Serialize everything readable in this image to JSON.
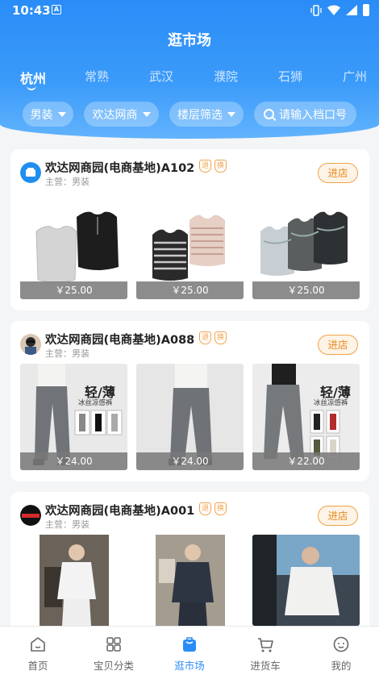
{
  "status_bar": {
    "time": "10:43",
    "app_icon_letter": "A"
  },
  "page_title": "逛市场",
  "cities": [
    "杭州",
    "常熟",
    "武汉",
    "濮院",
    "石狮",
    "广州"
  ],
  "active_city_index": 0,
  "filters": {
    "category": "男装",
    "market": "欢达网商",
    "floor": "楼层筛选",
    "search_placeholder": "请输入档口号"
  },
  "shops": [
    {
      "name": "欢达网商园(电商基地)A102",
      "tags": [
        "退",
        "换"
      ],
      "subtitle": "主营：男装",
      "enter_label": "进店",
      "products": [
        {
          "price": "￥25.00"
        },
        {
          "price": "￥25.00"
        },
        {
          "price": "￥25.00"
        }
      ]
    },
    {
      "name": "欢达网商园(电商基地)A088",
      "tags": [
        "退",
        "换"
      ],
      "subtitle": "主营：男装",
      "enter_label": "进店",
      "products": [
        {
          "price": "￥24.00",
          "overlay_big": "轻/薄",
          "overlay_small": "冰丝凉感裤"
        },
        {
          "price": "￥24.00"
        },
        {
          "price": "￥22.00",
          "overlay_big": "轻/薄",
          "overlay_small": "冰丝凉感裤"
        }
      ]
    },
    {
      "name": "欢达网商园(电商基地)A001",
      "tags": [
        "退",
        "换"
      ],
      "subtitle": "主营：男装",
      "enter_label": "进店",
      "products": [
        {
          "price": ""
        },
        {
          "price": ""
        },
        {
          "price": ""
        }
      ]
    }
  ],
  "tab_bar": [
    {
      "label": "首页",
      "icon": "home-icon"
    },
    {
      "label": "宝贝分类",
      "icon": "grid-icon"
    },
    {
      "label": "逛市场",
      "icon": "market-bag-icon"
    },
    {
      "label": "进货车",
      "icon": "cart-icon"
    },
    {
      "label": "我的",
      "icon": "profile-face-icon"
    }
  ],
  "active_tab_index": 2,
  "colors": {
    "accent": "#2a8cf7",
    "enter_button": "#e88a1a",
    "tag": "#f0a24a"
  }
}
